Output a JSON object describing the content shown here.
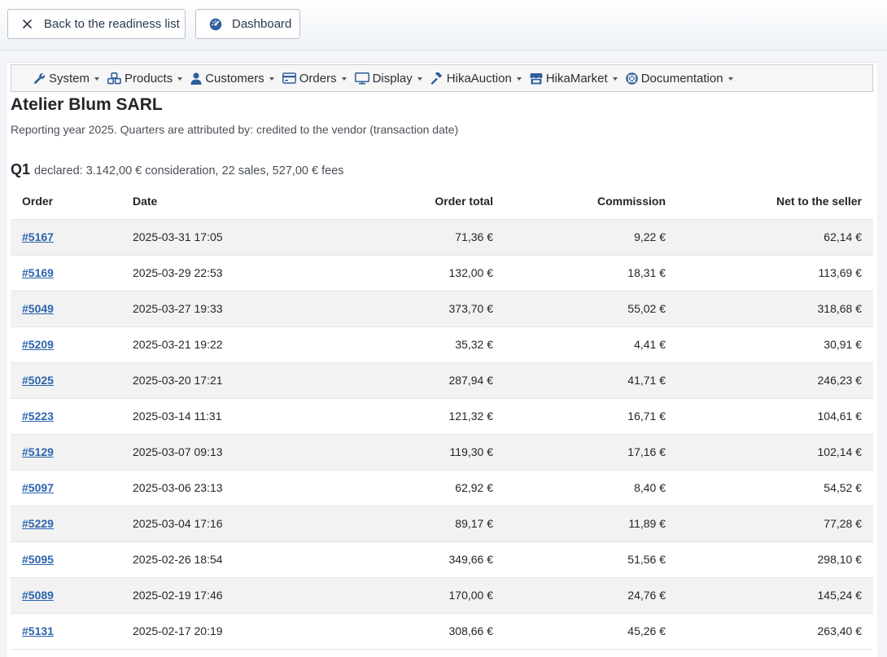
{
  "toolbar": {
    "back_label": "Back to the readiness list",
    "dashboard_label": "Dashboard"
  },
  "menu": [
    {
      "label": "System",
      "icon": "wrench-icon"
    },
    {
      "label": "Products",
      "icon": "cubes-icon"
    },
    {
      "label": "Customers",
      "icon": "user-icon"
    },
    {
      "label": "Orders",
      "icon": "credit-card-icon"
    },
    {
      "label": "Display",
      "icon": "desktop-icon"
    },
    {
      "label": "HikaAuction",
      "icon": "gavel-icon"
    },
    {
      "label": "HikaMarket",
      "icon": "store-icon"
    },
    {
      "label": "Documentation",
      "icon": "life-ring-icon"
    }
  ],
  "page": {
    "title": "Atelier Blum SARL",
    "subtitle": "Reporting year 2025. Quarters are attributed by: credited to the vendor (transaction date)"
  },
  "quarter": {
    "label": "Q1",
    "summary": "declared: 3.142,00 € consideration, 22 sales, 527,00 € fees"
  },
  "table": {
    "headers": {
      "order": "Order",
      "date": "Date",
      "total": "Order total",
      "commission": "Commission",
      "net": "Net to the seller"
    },
    "rows": [
      {
        "order": "#5167",
        "date": "2025-03-31 17:05",
        "total": "71,36 €",
        "commission": "9,22 €",
        "net": "62,14 €"
      },
      {
        "order": "#5169",
        "date": "2025-03-29 22:53",
        "total": "132,00 €",
        "commission": "18,31 €",
        "net": "113,69 €"
      },
      {
        "order": "#5049",
        "date": "2025-03-27 19:33",
        "total": "373,70 €",
        "commission": "55,02 €",
        "net": "318,68 €"
      },
      {
        "order": "#5209",
        "date": "2025-03-21 19:22",
        "total": "35,32 €",
        "commission": "4,41 €",
        "net": "30,91 €"
      },
      {
        "order": "#5025",
        "date": "2025-03-20 17:21",
        "total": "287,94 €",
        "commission": "41,71 €",
        "net": "246,23 €"
      },
      {
        "order": "#5223",
        "date": "2025-03-14 11:31",
        "total": "121,32 €",
        "commission": "16,71 €",
        "net": "104,61 €"
      },
      {
        "order": "#5129",
        "date": "2025-03-07 09:13",
        "total": "119,30 €",
        "commission": "17,16 €",
        "net": "102,14 €"
      },
      {
        "order": "#5097",
        "date": "2025-03-06 23:13",
        "total": "62,92 €",
        "commission": "8,40 €",
        "net": "54,52 €"
      },
      {
        "order": "#5229",
        "date": "2025-03-04 17:16",
        "total": "89,17 €",
        "commission": "11,89 €",
        "net": "77,28 €"
      },
      {
        "order": "#5095",
        "date": "2025-02-26 18:54",
        "total": "349,66 €",
        "commission": "51,56 €",
        "net": "298,10 €"
      },
      {
        "order": "#5089",
        "date": "2025-02-19 17:46",
        "total": "170,00 €",
        "commission": "24,76 €",
        "net": "145,24 €"
      },
      {
        "order": "#5131",
        "date": "2025-02-17 20:19",
        "total": "308,66 €",
        "commission": "45,26 €",
        "net": "263,40 €"
      }
    ]
  },
  "colors": {
    "link": "#2b64ad",
    "menu_icon": "#2f5f9e",
    "row_stripe": "#f2f2f2"
  }
}
